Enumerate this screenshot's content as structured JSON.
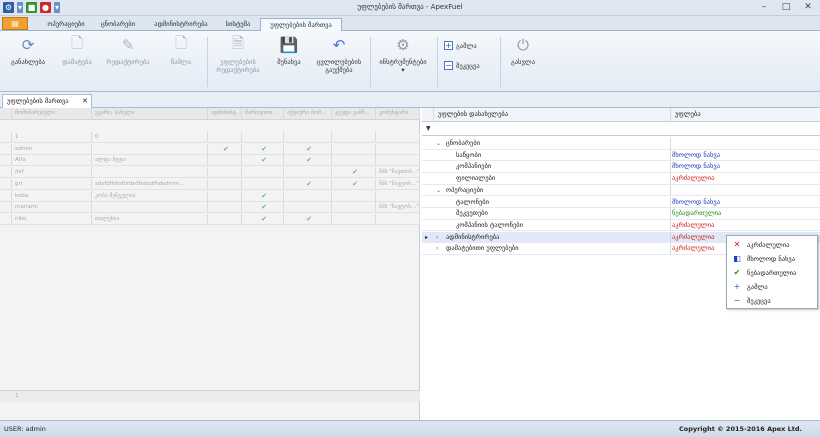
{
  "window": {
    "title": "უფლებების მართვა - ApexFuel"
  },
  "ribbon_tabs": [
    "ოპერაციები",
    "ცნობარები",
    "ადმინისტრირება",
    "სისტემა",
    "უფლებების მართვა"
  ],
  "ribbon": {
    "refresh": "განახლება",
    "add": "დამატება",
    "edit": "რედაქტირება",
    "delete": "წაშლა",
    "edit_rights_l1": "უფლებების",
    "edit_rights_l2": "რედაქტირება",
    "save": "შენახვა",
    "undo_l1": "ცვლილებების",
    "undo_l2": "გაუქმება",
    "instruments": "ინსტრუმენტები",
    "expand": "გაშლა",
    "collapse": "შეკეცვა",
    "exit": "გასვლა"
  },
  "doc_tab": "უფლებების მართვა",
  "left_grid": {
    "columns": [
      "მომხმარებელი",
      "გვარი, სახელი",
      "ადმინისტ...",
      "მართვითი...",
      "აქტიური მომ...",
      "ჯგუფი გამმ...",
      "კომენტარი"
    ],
    "rows": [
      {
        "login": "1",
        "name": "0",
        "checks": [
          false,
          false,
          false,
          false
        ],
        "comment": ""
      },
      {
        "login": "admin",
        "name": "",
        "checks": [
          true,
          true,
          true,
          false
        ],
        "comment": ""
      },
      {
        "login": "Alfa",
        "name": "ალფა ზედა",
        "checks": [
          false,
          true,
          true,
          false
        ],
        "comment": ""
      },
      {
        "login": "def",
        "name": "",
        "checks": [
          false,
          false,
          false,
          true
        ],
        "comment": "შპს \"ნავთობ...\""
      },
      {
        "login": "grr",
        "name": "sdsfdfhfsdhfdsdfsdsdfhdsdmm...",
        "checks": [
          false,
          false,
          true,
          true
        ],
        "comment": "შპს \"ნავტოხ...\""
      },
      {
        "login": "koba",
        "name": "კობა შენგელია",
        "checks": [
          false,
          true,
          false,
          false
        ],
        "comment": ""
      },
      {
        "login": "mariami",
        "name": "",
        "checks": [
          false,
          true,
          false,
          false
        ],
        "comment": "შპს \"ნავტოხ...\""
      },
      {
        "login": "niko",
        "name": "თილეხია",
        "checks": [
          false,
          true,
          true,
          false
        ],
        "comment": ""
      }
    ],
    "footer_count": "1"
  },
  "right_grid": {
    "col_name": "უფლების დასახელება",
    "col_perm": "უფლება",
    "filter_mark": "▼"
  },
  "tree": [
    {
      "level": 0,
      "toggle": "⌄",
      "name": "ცნობარები",
      "perm": "",
      "perm_color": ""
    },
    {
      "level": 1,
      "toggle": "",
      "name": "საწყობი",
      "perm": "მხოლოდ ნახვა",
      "perm_color": "blue"
    },
    {
      "level": 1,
      "toggle": "",
      "name": "კომპანიები",
      "perm": "მხოლოდ ნახვა",
      "perm_color": "blue"
    },
    {
      "level": 1,
      "toggle": "",
      "name": "ფილიალები",
      "perm": "აკრძალულია",
      "perm_color": "red"
    },
    {
      "level": 0,
      "toggle": "⌄",
      "name": "ოპერაციები",
      "perm": "",
      "perm_color": ""
    },
    {
      "level": 1,
      "toggle": "",
      "name": "ტალონები",
      "perm": "მხოლოდ ნახვა",
      "perm_color": "blue"
    },
    {
      "level": 1,
      "toggle": "",
      "name": "შეკვეთები",
      "perm": "ნებადართულია",
      "perm_color": "green"
    },
    {
      "level": 1,
      "toggle": "",
      "name": "კომპანიის ტალონები",
      "perm": "აკრძალულია",
      "perm_color": "red"
    },
    {
      "level": 0,
      "toggle": "›",
      "name": "ადმინისტრირება",
      "perm": "აკრძალულია",
      "perm_color": "red",
      "selected": true
    },
    {
      "level": 0,
      "toggle": "›",
      "name": "დამატებითი უფლებები",
      "perm": "აკრძალულია",
      "perm_color": "red"
    }
  ],
  "context_menu": [
    {
      "icon": "✕",
      "label": "აკრძალულია",
      "color": "#d01818"
    },
    {
      "icon": "◧",
      "label": "მხოლოდ ნახვა",
      "color": "#1a3cbf"
    },
    {
      "icon": "✔",
      "label": "ნებადართულია",
      "color": "#1e8e1e"
    },
    {
      "icon": "+",
      "label": "გაშლა",
      "color": "#2b5ea8"
    },
    {
      "icon": "−",
      "label": "შეკეცვა",
      "color": "#2b5ea8"
    }
  ],
  "status": {
    "user": "USER: admin",
    "copyright": "Copyright © 2015-2016 Apex Ltd."
  }
}
